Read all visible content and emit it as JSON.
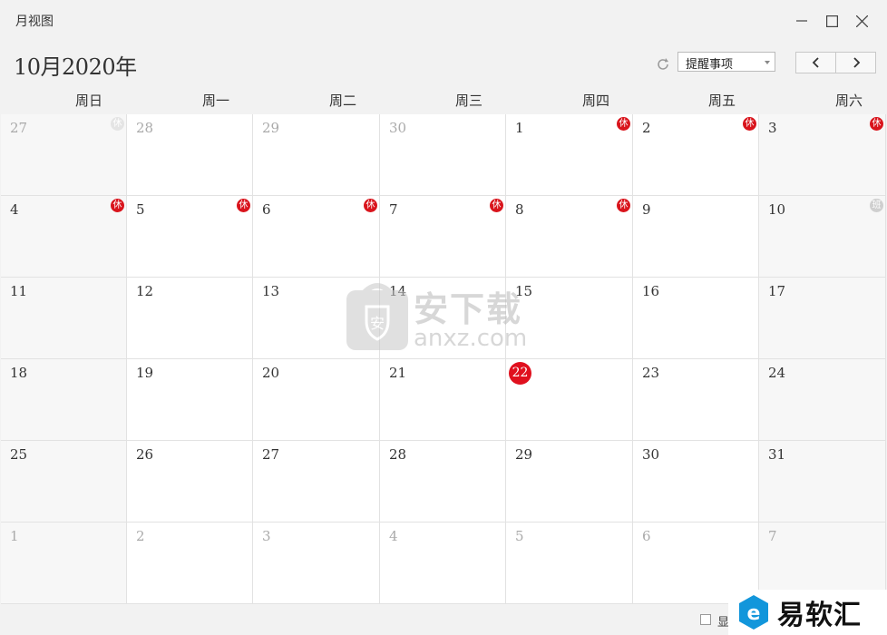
{
  "window": {
    "title": "月视图"
  },
  "toolbar": {
    "month_label": "10月2020年",
    "filter": {
      "selected": "提醒事项"
    }
  },
  "weekdays": [
    "周日",
    "周一",
    "周二",
    "周三",
    "周四",
    "周五",
    "周六"
  ],
  "weeks": [
    [
      {
        "day": "27",
        "other": true,
        "badge": "休",
        "badge_type": "faded"
      },
      {
        "day": "28",
        "other": true
      },
      {
        "day": "29",
        "other": true
      },
      {
        "day": "30",
        "other": true
      },
      {
        "day": "1",
        "badge": "休",
        "badge_type": "rest"
      },
      {
        "day": "2",
        "badge": "休",
        "badge_type": "rest"
      },
      {
        "day": "3",
        "badge": "休",
        "badge_type": "rest"
      }
    ],
    [
      {
        "day": "4",
        "badge": "休",
        "badge_type": "rest"
      },
      {
        "day": "5",
        "badge": "休",
        "badge_type": "rest"
      },
      {
        "day": "6",
        "badge": "休",
        "badge_type": "rest"
      },
      {
        "day": "7",
        "badge": "休",
        "badge_type": "rest"
      },
      {
        "day": "8",
        "badge": "休",
        "badge_type": "rest"
      },
      {
        "day": "9"
      },
      {
        "day": "10",
        "badge": "班",
        "badge_type": "work"
      }
    ],
    [
      {
        "day": "11"
      },
      {
        "day": "12"
      },
      {
        "day": "13"
      },
      {
        "day": "14"
      },
      {
        "day": "15"
      },
      {
        "day": "16"
      },
      {
        "day": "17"
      }
    ],
    [
      {
        "day": "18"
      },
      {
        "day": "19"
      },
      {
        "day": "20"
      },
      {
        "day": "21"
      },
      {
        "day": "22",
        "today": true
      },
      {
        "day": "23"
      },
      {
        "day": "24"
      }
    ],
    [
      {
        "day": "25"
      },
      {
        "day": "26"
      },
      {
        "day": "27"
      },
      {
        "day": "28"
      },
      {
        "day": "29"
      },
      {
        "day": "30"
      },
      {
        "day": "31"
      }
    ],
    [
      {
        "day": "1",
        "other": true
      },
      {
        "day": "2",
        "other": true
      },
      {
        "day": "3",
        "other": true
      },
      {
        "day": "4",
        "other": true
      },
      {
        "day": "5",
        "other": true
      },
      {
        "day": "6",
        "other": true
      },
      {
        "day": "7",
        "other": true
      }
    ]
  ],
  "footer": {
    "checkbox_label": "显"
  },
  "watermark": {
    "cn": "安下载",
    "en": "anxz.com"
  },
  "logo": {
    "text": "易软汇"
  },
  "colors": {
    "today": "#e0101e",
    "rest_badge": "#d9141c",
    "work_badge": "#cfcfcf",
    "accent": "#1296db"
  }
}
